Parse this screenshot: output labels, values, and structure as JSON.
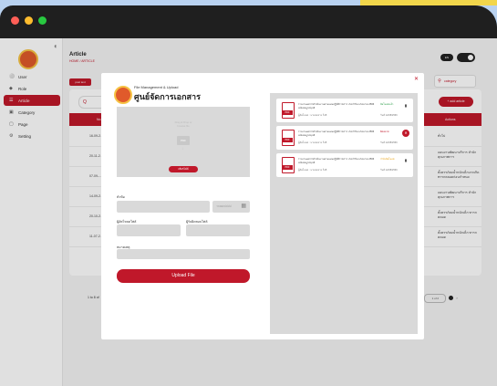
{
  "colors": {
    "accent": "#c0182a",
    "success": "#2e9e4a",
    "warning": "#e8a317",
    "error": "#c0182a"
  },
  "window": {
    "dots": [
      "#ff5f57",
      "#febc2e",
      "#28c840"
    ]
  },
  "sidebar": {
    "items": [
      {
        "label": "User",
        "icon": "user-icon"
      },
      {
        "label": "Role",
        "icon": "shield-icon"
      },
      {
        "label": "Article",
        "icon": "article-icon",
        "active": true
      },
      {
        "label": "Category",
        "icon": "folder-icon"
      },
      {
        "label": "Page",
        "icon": "page-icon"
      },
      {
        "label": "Setting",
        "icon": "gear-icon"
      }
    ]
  },
  "header": {
    "title": "Article",
    "breadcrumb": "HOME / ARTICLE",
    "lang": "EN"
  },
  "toolbar": {
    "left_button": "post text",
    "search_placeholder": "category"
  },
  "table": {
    "search": "Q",
    "add_label": "+ add article",
    "headers": [
      "No.",
      "Actions"
    ],
    "rows": [
      {
        "date": "16-09-2...",
        "desc": "ทั่วไป"
      },
      {
        "date": "20-11-2...",
        "desc": "แผนงานพัฒนาบริการ สำนักคุณภาพการ"
      },
      {
        "date": "07-09-...",
        "desc": "ตั้งครรภ์ลดน้ำหนักเด็กแรกเกิดทารกคลอดก่อนกำหนด"
      },
      {
        "date": "14-09-2...",
        "desc": "แผนงานพัฒนาบริการ สำนักคุณภาพการ"
      },
      {
        "date": "20-10-2...",
        "desc": "ตั้งครรภ์ลดน้ำหนักเด็ก ทารกคลอด"
      },
      {
        "date": "11-07-2...",
        "desc": "ตั้งครรภ์ลดน้ำหนักเด็ก ทารกคลอด"
      }
    ],
    "footer": "1 to 8 of",
    "pager": "1 of 2"
  },
  "modal": {
    "subtitle": "File Management & Upload",
    "title": "ศูนย์จัดการเอกสาร",
    "dropzone": {
      "hint": "Drag & Drop or browse file",
      "pdf": "PDF",
      "button": "เลือกไฟล์"
    },
    "fields": {
      "title_label": "หัวข้อ",
      "date_placeholder": "วว/ดด/ปปปป",
      "uploader_label": "ผู้อัพโหลดไฟล์",
      "owner_label": "ผู้รับผิดชอบไฟล์",
      "note_label": "หมายเหตุ"
    },
    "upload_label": "Upload File",
    "files": [
      {
        "name": "รายงานผลการดำเนินงานตามแผนปฏิบัติราชการ ประจำปีงบประมาณ 2566 ฉบับสมบูรณ์.pdf",
        "uploader": "ผู้อัพโหลด : นายสมชาย ใจดี",
        "status": "อัพโหลดแล้ว",
        "status_color": "#2e9e4a",
        "date": "วันที่ 12/08/2566",
        "action": "trash-icon"
      },
      {
        "name": "รายงานผลการดำเนินงานตามแผนปฏิบัติราชการ ประจำปีงบประมาณ 2566 ฉบับสมบูรณ์.pdf",
        "uploader": "ผู้อัพโหลด : นายสมชาย ใจดี",
        "status": "ผิดพลาด",
        "status_color": "#c0182a",
        "date": "วันที่ 12/08/2566",
        "action": "close-icon"
      },
      {
        "name": "รายงานผลการดำเนินงานตามแผนปฏิบัติราชการ ประจำปีงบประมาณ 2566 ฉบับสมบูรณ์.pdf",
        "uploader": "ผู้อัพโหลด : นายสมชาย ใจดี",
        "status": "กำลังอัพโหลด",
        "status_color": "#e8a317",
        "date": "วันที่ 12/08/2566",
        "action": "trash-icon"
      }
    ]
  }
}
